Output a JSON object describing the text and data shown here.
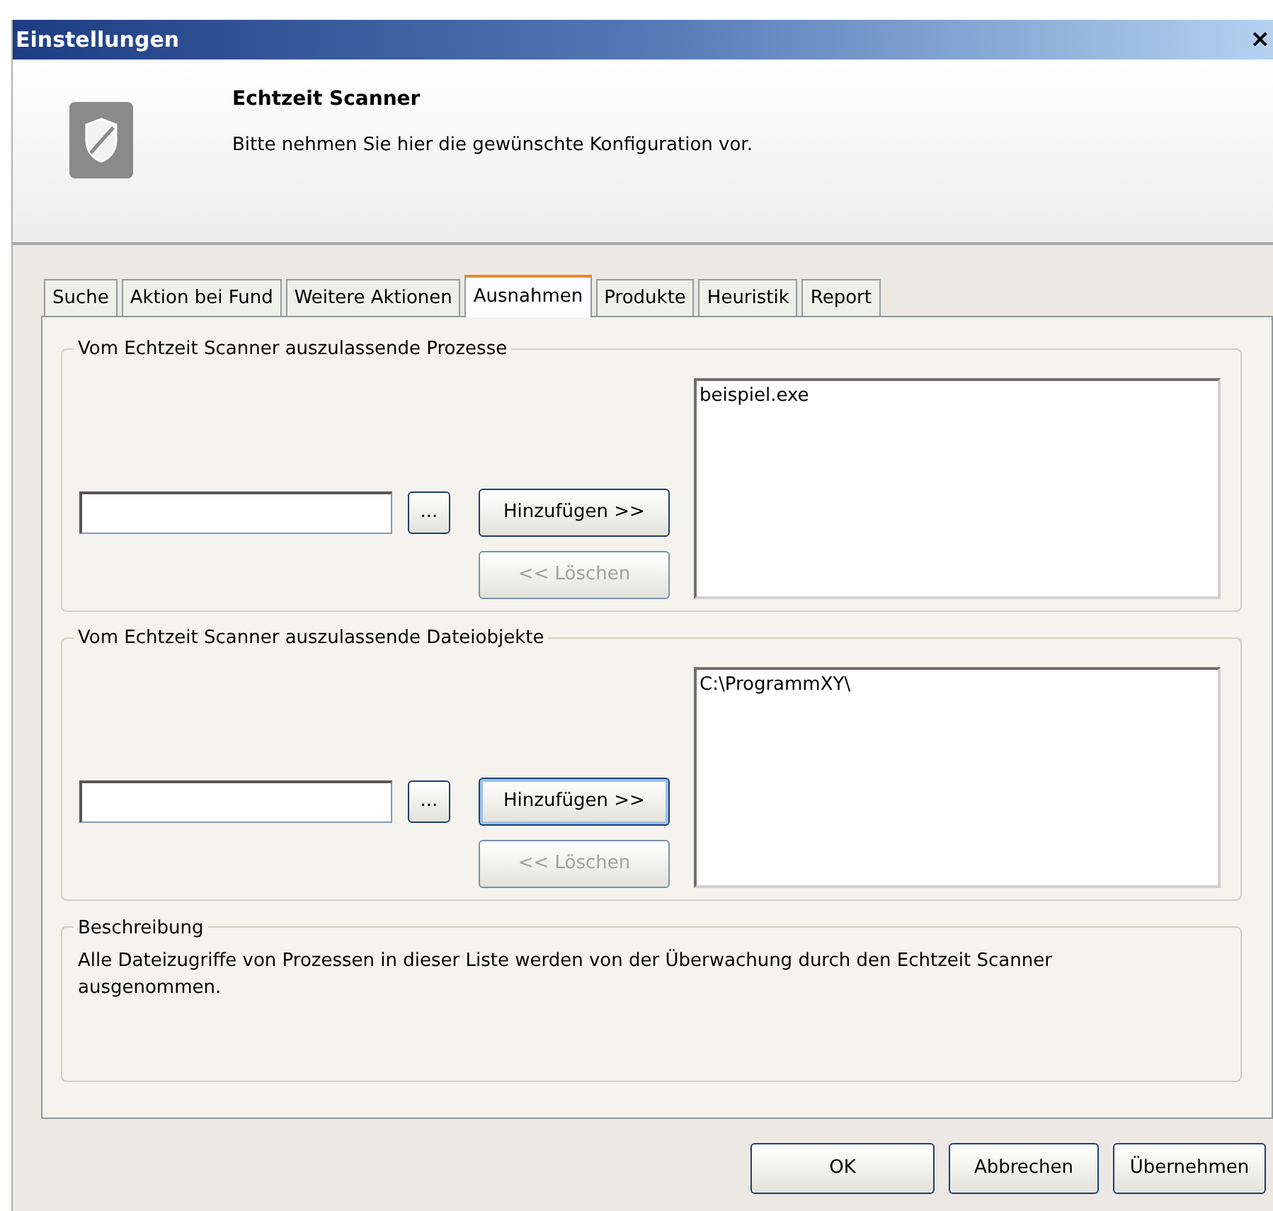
{
  "window": {
    "title": "Einstellungen",
    "close": "×"
  },
  "header": {
    "title": "Echtzeit Scanner",
    "subtitle": "Bitte nehmen Sie hier die gewünschte Konfiguration vor."
  },
  "tabs": [
    {
      "label": "Suche",
      "selected": false
    },
    {
      "label": "Aktion bei Fund",
      "selected": false
    },
    {
      "label": "Weitere Aktionen",
      "selected": false
    },
    {
      "label": "Ausnahmen",
      "selected": true
    },
    {
      "label": "Produkte",
      "selected": false
    },
    {
      "label": "Heuristik",
      "selected": false
    },
    {
      "label": "Report",
      "selected": false
    }
  ],
  "groups": [
    {
      "title": "Vom Echtzeit Scanner auszulassende Prozesse",
      "browse": "...",
      "add": {
        "label": "Hinzufügen >>",
        "focused": false,
        "disabled": false
      },
      "remove": {
        "label": "<< Löschen",
        "focused": false,
        "disabled": true
      },
      "items": [
        "beispiel.exe"
      ]
    },
    {
      "title": "Vom Echtzeit Scanner auszulassende Dateiobjekte",
      "browse": "...",
      "add": {
        "label": "Hinzufügen >>",
        "focused": true,
        "disabled": false
      },
      "remove": {
        "label": "<< Löschen",
        "focused": false,
        "disabled": true
      },
      "items": [
        "C:\\ProgrammXY\\"
      ]
    }
  ],
  "description": {
    "title": "Beschreibung",
    "text": "Alle Dateizugriffe von Prozessen in dieser Liste werden von der Überwachung durch den Echtzeit Scanner ausgenommen."
  },
  "buttons": [
    "OK",
    "Abbrechen",
    "Übernehmen"
  ]
}
